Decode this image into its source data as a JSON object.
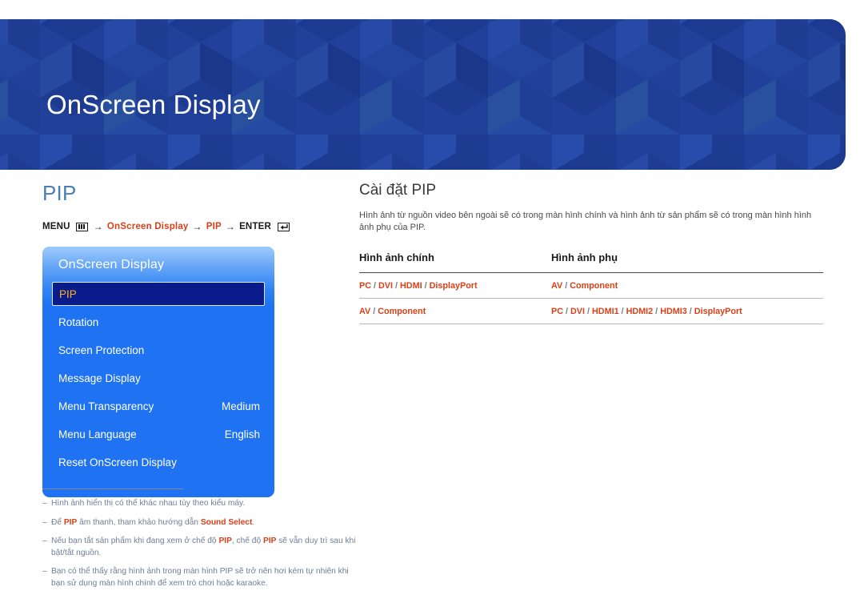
{
  "banner": {
    "title": "OnScreen Display",
    "colors": {
      "base": "#20409a",
      "light": "#2a4ba8",
      "dark": "#1c3893"
    }
  },
  "left": {
    "section_title": "PIP",
    "breadcrumb": {
      "menu_label": "MENU",
      "menu_icon": "menu-grid-icon",
      "arrow": "→",
      "path1": "OnScreen Display",
      "path2": "PIP",
      "enter_label": "ENTER",
      "enter_icon": "enter-key-icon"
    },
    "osd": {
      "header": "OnScreen Display",
      "rows": [
        {
          "label": "PIP",
          "value": "",
          "selected": true
        },
        {
          "label": "Rotation",
          "value": "",
          "selected": false
        },
        {
          "label": "Screen Protection",
          "value": "",
          "selected": false
        },
        {
          "label": "Message Display",
          "value": "",
          "selected": false
        },
        {
          "label": "Menu Transparency",
          "value": "Medium",
          "selected": false
        },
        {
          "label": "Menu Language",
          "value": "English",
          "selected": false
        },
        {
          "label": "Reset OnScreen Display",
          "value": "",
          "selected": false
        }
      ]
    },
    "footnotes": [
      {
        "dash": "–",
        "parts": [
          {
            "t": "Hình ảnh hiển thị có thể khác nhau tùy theo kiểu máy.",
            "b": false
          }
        ]
      },
      {
        "dash": "–",
        "parts": [
          {
            "t": "Để ",
            "b": false
          },
          {
            "t": "PIP",
            "b": true
          },
          {
            "t": " âm thanh, tham khảo hướng dẫn ",
            "b": false
          },
          {
            "t": "Sound Select",
            "b": true
          },
          {
            "t": ".",
            "b": false
          }
        ]
      },
      {
        "dash": "–",
        "parts": [
          {
            "t": "Nếu bạn tắt sản phẩm khi đang xem ở chế độ ",
            "b": false
          },
          {
            "t": "PIP",
            "b": true
          },
          {
            "t": ", chế độ ",
            "b": false
          },
          {
            "t": "PIP",
            "b": true
          },
          {
            "t": " sẽ vẫn duy trì sau khi bật/tắt nguồn.",
            "b": false
          }
        ]
      },
      {
        "dash": "–",
        "parts": [
          {
            "t": "Bạn có thể thấy rằng hình ảnh trong màn hình PIP sẽ trở nên hơi kém tự nhiên khi bạn sử dụng màn hình chính để xem trò chơi hoặc karaoke.",
            "b": false
          }
        ]
      }
    ]
  },
  "right": {
    "title": "Cài đặt PIP",
    "description": "Hình ảnh từ nguồn video bên ngoài sẽ có trong màn hình chính và hình ảnh từ sản phẩm sẽ có trong màn hình hình ảnh phụ của PIP.",
    "table": {
      "headers": [
        "Hình ảnh chính",
        "Hình ảnh phụ"
      ],
      "rows": [
        {
          "main": [
            "PC",
            "DVI",
            "HDMI",
            "DisplayPort"
          ],
          "sub": [
            "AV",
            "Component"
          ]
        },
        {
          "main": [
            "AV",
            "Component"
          ],
          "sub": [
            "PC",
            "DVI",
            "HDMI1",
            "HDMI2",
            "HDMI3",
            "DisplayPort"
          ]
        }
      ],
      "separator": "/"
    }
  },
  "colors": {
    "accent_red": "#d9401a",
    "banner_blue": "#20409a",
    "osd_blue": "#1f72f2",
    "osd_selected_bg": "#0a1b8c",
    "osd_selected_text": "#ffb01e",
    "section_title_blue": "#4a7ebb",
    "footnote_gray": "#6f7f96"
  }
}
